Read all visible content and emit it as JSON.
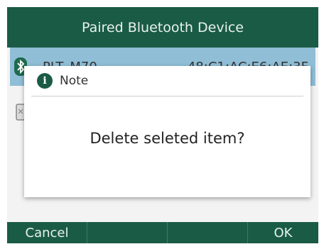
{
  "title": "Paired Bluetooth Device",
  "devices": [
    {
      "name": "PLT_M70",
      "mac": "48:C1:AC:E6:AE:3F",
      "icon": "bluetooth-icon"
    },
    {
      "name": "",
      "mac": "",
      "icon": "device-icon"
    }
  ],
  "dialog": {
    "title": "Note",
    "message": "Delete seleted item?",
    "icon": "info-icon"
  },
  "softkeys": [
    "Cancel",
    "",
    "",
    "OK"
  ],
  "colors": {
    "header": "#1a5b45",
    "selected_row": "#8fbed6",
    "softkey_text": "#e8f2ed"
  }
}
